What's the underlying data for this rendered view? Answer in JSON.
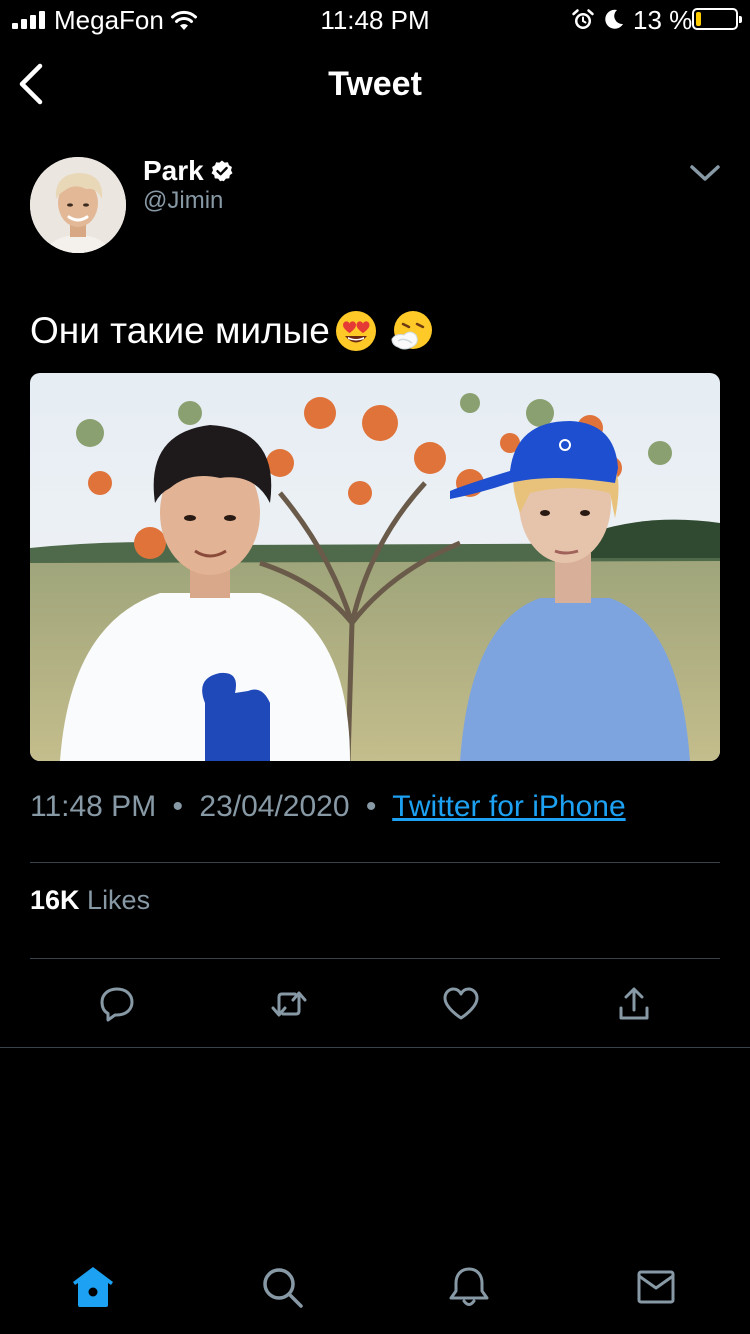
{
  "status_bar": {
    "carrier": "MegaFon",
    "time": "11:48 PM",
    "battery_percent": "13 %",
    "battery_level": 0.13
  },
  "header": {
    "title": "Tweet"
  },
  "tweet": {
    "author_name": "Park",
    "author_handle": "@Jimin",
    "text": "Они такие милые",
    "emojis": [
      "heart-eyes-emoji",
      "sneezing-face-emoji"
    ],
    "time": "11:48 PM",
    "separator": "•",
    "date": "23/04/2020",
    "source": "Twitter for iPhone",
    "likes_count": "16K",
    "likes_label": "Likes"
  },
  "actions": [
    "reply-icon",
    "retweet-icon",
    "like-icon",
    "share-icon"
  ],
  "tab_bar": [
    "home-icon",
    "search-icon",
    "notifications-icon",
    "messages-icon"
  ],
  "colors": {
    "background": "#000000",
    "accent": "#1da1f2",
    "secondary_text": "#8899a6",
    "divider": "#38444d",
    "battery_low": "#ffcc00"
  }
}
